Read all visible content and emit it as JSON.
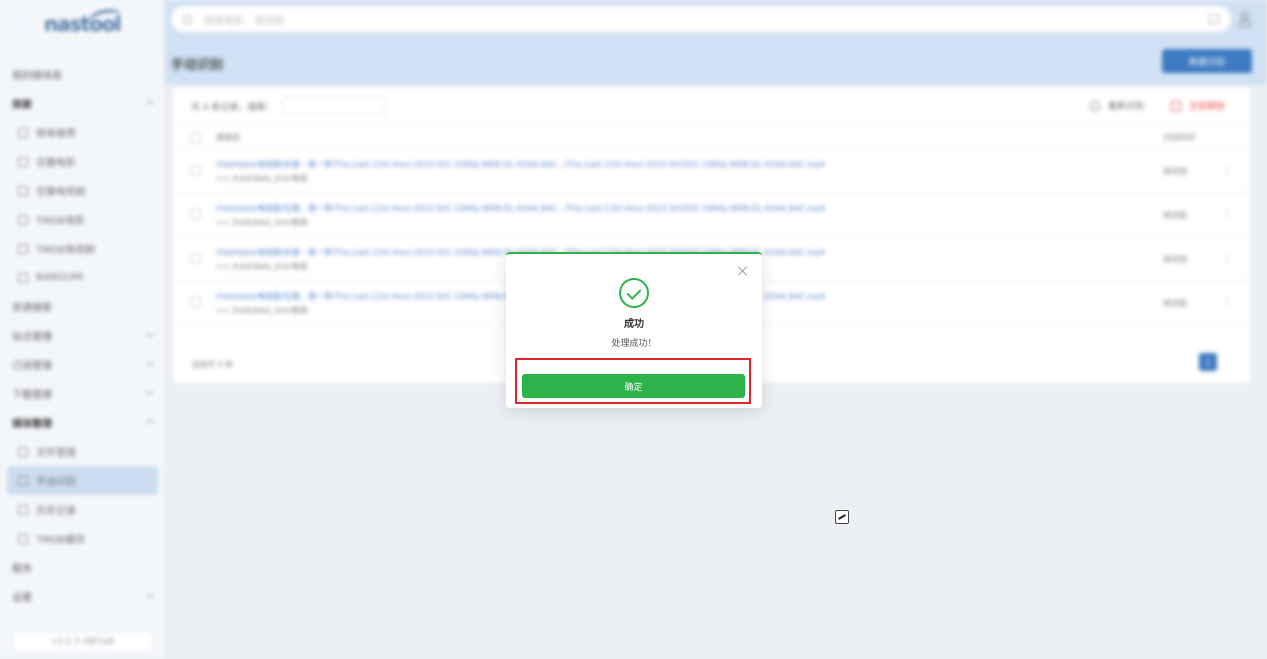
{
  "sidebar": {
    "logo": "nastool",
    "items": [
      {
        "label": "我的媒体库",
        "type": "link"
      },
      {
        "label": "探索",
        "type": "group",
        "expanded": true
      },
      {
        "label": "榜单推荐",
        "type": "sub"
      },
      {
        "label": "豆瓣电影",
        "type": "sub"
      },
      {
        "label": "豆瓣电视剧",
        "type": "sub"
      },
      {
        "label": "TMDB电影",
        "type": "sub"
      },
      {
        "label": "TMDB电视剧",
        "type": "sub"
      },
      {
        "label": "BANGUMI",
        "type": "sub"
      },
      {
        "label": "资源搜索",
        "type": "link"
      },
      {
        "label": "站点管理",
        "type": "collapsed"
      },
      {
        "label": "订阅管理",
        "type": "collapsed"
      },
      {
        "label": "下载管理",
        "type": "collapsed"
      },
      {
        "label": "媒体整理",
        "type": "group",
        "expanded": true
      },
      {
        "label": "文件管理",
        "type": "sub"
      },
      {
        "label": "手动识别",
        "type": "sub",
        "active": true
      },
      {
        "label": "历史记录",
        "type": "sub"
      },
      {
        "label": "TMDB缓存",
        "type": "sub"
      },
      {
        "label": "服务",
        "type": "link"
      },
      {
        "label": "设置",
        "type": "collapsed"
      }
    ],
    "version": "v3.2.3 d8f3a6"
  },
  "header": {
    "search_placeholder": "搜索电影、电视剧",
    "page_title": "手动识别",
    "new_button": "新建识别"
  },
  "table": {
    "toolbar_label": "共 4 条记录，搜索：",
    "refresh_label": "重新识别",
    "delete_label": "全部删除",
    "columns": {
      "path": "源路径",
      "time": "识别时间"
    },
    "rows": [
      {
        "path": "/hdd/data/电视剧/狂飙 - 第一季/The.Last.11th.Hour.2023.S01.1080p.WEB-DL.H264.AAC.../The.Last.11th.Hour.2023.S01E01.1080p.WEB-DL.H264.AAC.mp4",
        "sub": "=> /hdd/data_link/电视",
        "time": "待识别"
      },
      {
        "path": "/hdd/data/电视剧/狂飙 - 第一季/The.Last.11th.Hour.2023.S01.1080p.WEB-DL.H264.AAC.../The.Last.11th.Hour.2023.S01E02.1080p.WEB-DL.H264.AAC.mp4",
        "sub": "=> /hdd/data_link/电视",
        "time": "待识别"
      },
      {
        "path": "/hdd/data/电视剧/狂飙 - 第一季/The.Last.11th.Hour.2023.S01.1080p.WEB-DL.H264.AAC.../The.Last.11th.Hour.2023.S01E03.1080p.WEB-DL.H264.AAC.mp4",
        "sub": "=> /hdd/data_link/电视",
        "time": "待识别"
      },
      {
        "path": "/hdd/data/电视剧/狂飙 - 第一季/The.Last.11th.Hour.2023.S01.1080p.WEB-DL.H264.AAC.../The.Last.11th.Hour.2023.S01E04.1080p.WEB-DL.H264.AAC.mp4",
        "sub": "=> /hdd/data_link/电视",
        "time": "待识别"
      }
    ],
    "footer": "当前共 4 条",
    "page": "1"
  },
  "modal": {
    "title": "成功",
    "message": "处理成功！",
    "confirm_label": "确定",
    "accent_color": "#2eb34a",
    "highlight_color": "#e0262d"
  }
}
